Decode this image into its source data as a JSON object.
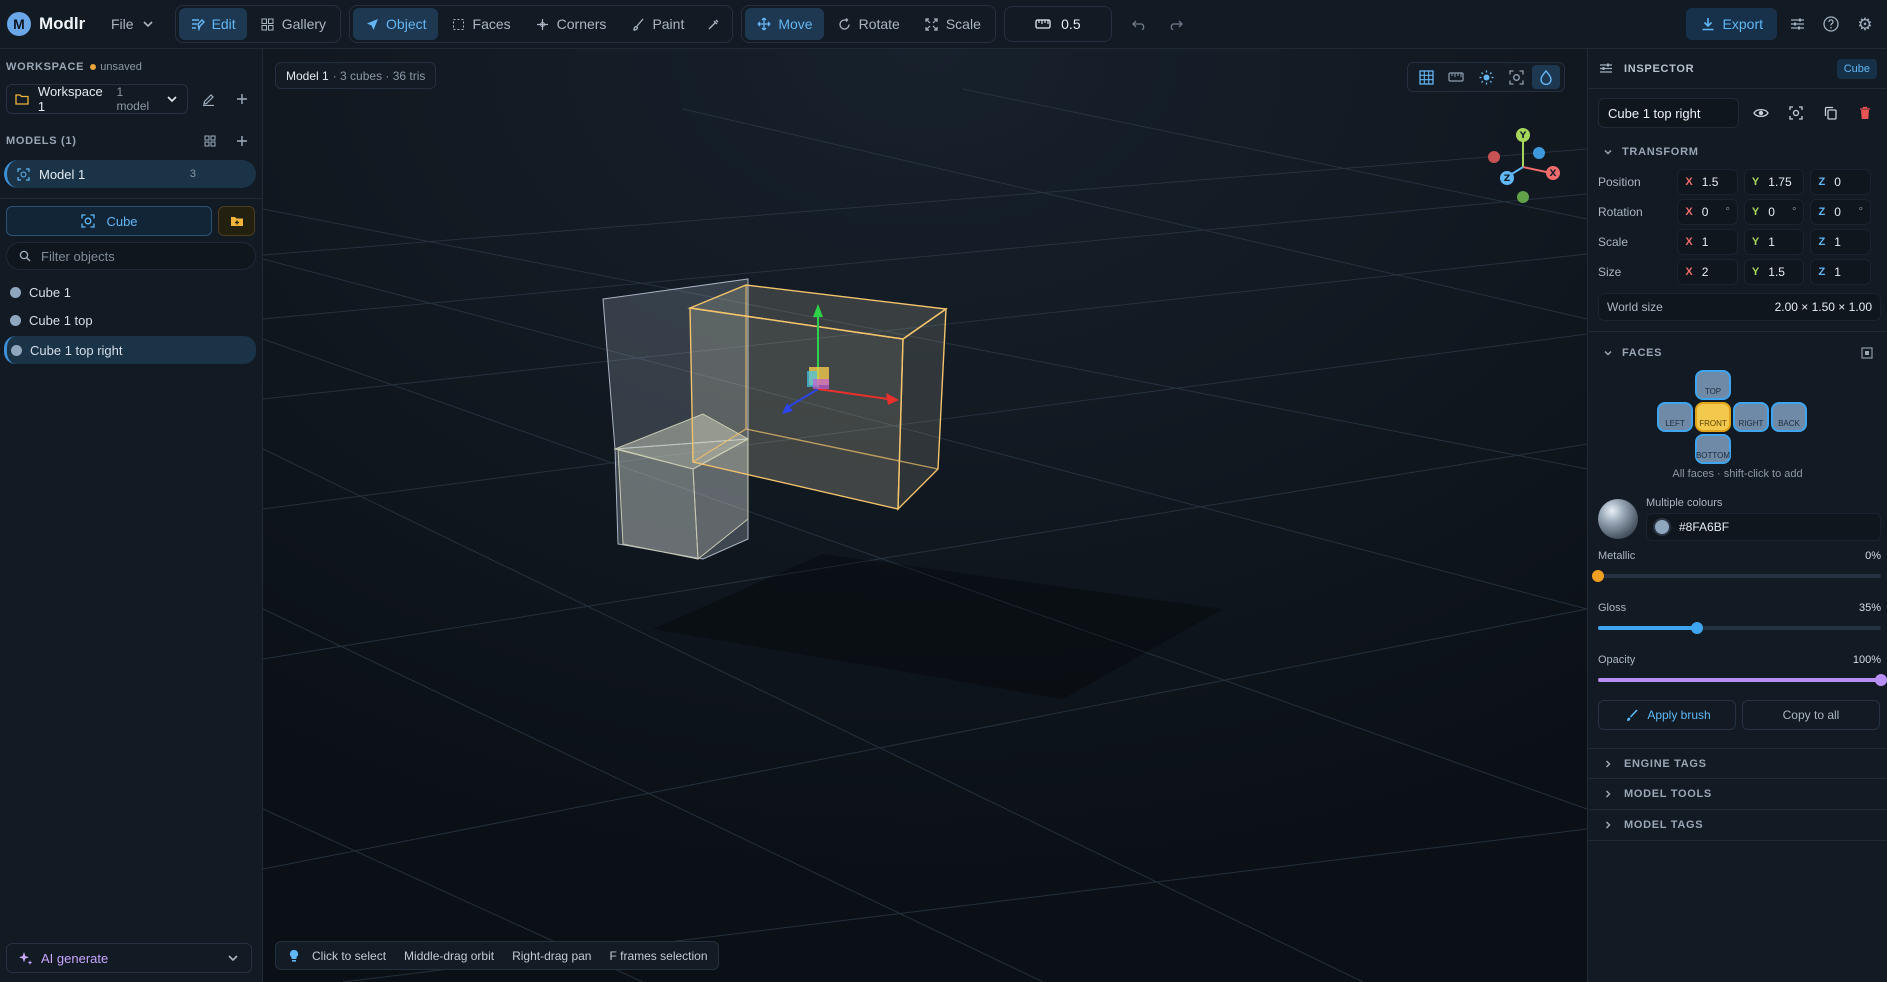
{
  "app": {
    "logo_letter": "M",
    "name": "Modlr"
  },
  "toolbar": {
    "file": "File",
    "modes": [
      "Edit",
      "Gallery"
    ],
    "select_modes": [
      "Object",
      "Faces",
      "Corners",
      "Paint"
    ],
    "transform_modes": [
      "Move",
      "Rotate",
      "Scale"
    ],
    "snap_value": "0.5",
    "export": "Export"
  },
  "workspace": {
    "heading": "WORKSPACE",
    "status": "unsaved",
    "name": "Workspace 1",
    "count": "1 model"
  },
  "models": {
    "heading": "MODELS (1)",
    "items": [
      {
        "name": "Model 1",
        "count": "3"
      }
    ]
  },
  "objects": {
    "add_label": "Cube",
    "filter_placeholder": "Filter objects",
    "items": [
      "Cube 1",
      "Cube 1 top",
      "Cube 1 top right"
    ]
  },
  "ai": {
    "label": "AI generate"
  },
  "viewport": {
    "model_name": "Model 1",
    "model_stats": "· 3 cubes · 36 tris",
    "hints": [
      "Click to select",
      "Middle-drag orbit",
      "Right-drag pan",
      "F frames selection"
    ],
    "gizmo": {
      "x": "X",
      "y": "Y",
      "z": "Z"
    }
  },
  "inspector": {
    "heading": "INSPECTOR",
    "type": "Cube",
    "object_name": "Cube 1 top right",
    "transform": {
      "heading": "TRANSFORM",
      "rows": [
        {
          "label": "Position",
          "x": "1.5",
          "y": "1.75",
          "z": "0"
        },
        {
          "label": "Rotation",
          "x": "0",
          "y": "0",
          "z": "0",
          "unit": "°"
        },
        {
          "label": "Scale",
          "x": "1",
          "y": "1",
          "z": "1"
        },
        {
          "label": "Size",
          "x": "2",
          "y": "1.5",
          "z": "1"
        }
      ],
      "world_label": "World size",
      "world_value": "2.00 × 1.50 × 1.00"
    },
    "faces": {
      "heading": "FACES",
      "top": "TOP",
      "left": "LEFT",
      "front": "FRONT",
      "right": "RIGHT",
      "back": "BACK",
      "bottom": "BOTTOM",
      "note": "All faces · shift-click to add"
    },
    "material": {
      "title": "Multiple colours",
      "hex": "#8FA6BF",
      "swatch_color": "#8FA6BF",
      "metallic_label": "Metallic",
      "metallic": "0%",
      "metallic_value": 0,
      "gloss_label": "Gloss",
      "gloss": "35%",
      "gloss_value": 0.35,
      "opacity_label": "Opacity",
      "opacity": "100%",
      "opacity_value": 1.0
    },
    "apply_brush": "Apply brush",
    "copy_to_all": "Copy to all",
    "sections": [
      "ENGINE TAGS",
      "MODEL TOOLS",
      "MODEL TAGS"
    ]
  }
}
